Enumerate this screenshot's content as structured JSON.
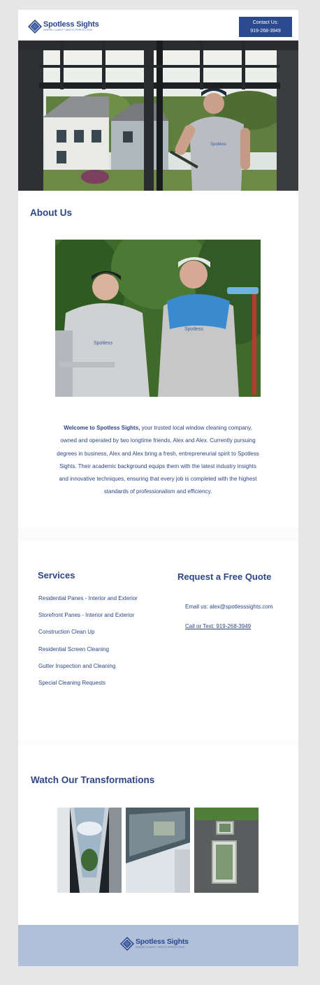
{
  "brand": {
    "name": "Spotless Sights",
    "tagline": "WHERE CLARITY MEETS PERFECTION",
    "color": "#2b4a90"
  },
  "header": {
    "contact_line1": "Contact Us:",
    "contact_line2": "919-268-3949"
  },
  "about": {
    "title": "About Us",
    "intro_bold": "Welcome to Spotless Sights,",
    "body": " your trusted local window cleaning company, owned and operated by two longtime friends, Alex and Alex. Currently pursuing degrees in business, Alex and Alex bring a fresh, entrepreneurial spirit to Spotless Sights. Their academic background equips them with the latest industry insights and innovative techniques, ensuring that every job is completed with the highest standards of professionalism and efficiency."
  },
  "services": {
    "title": "Services",
    "items": [
      "Residential Panes - Interior and Exterior",
      "Storefront Panes - Interior and Exterior",
      "Construction Clean Up",
      "Residential Screen Cleaning",
      "Gutter Inspection and Cleaning",
      "Special Cleaning Requests"
    ]
  },
  "quote": {
    "title": "Request a Free Quote",
    "email": "Email us: alex@spotlesssights.com",
    "call": "Call or Text: 919-268-3949"
  },
  "transformations": {
    "title": "Watch Our Transformations"
  },
  "footer": {
    "name": "Spotless Sights",
    "tagline": "WHERE CLARITY MEETS PERFECTION"
  }
}
